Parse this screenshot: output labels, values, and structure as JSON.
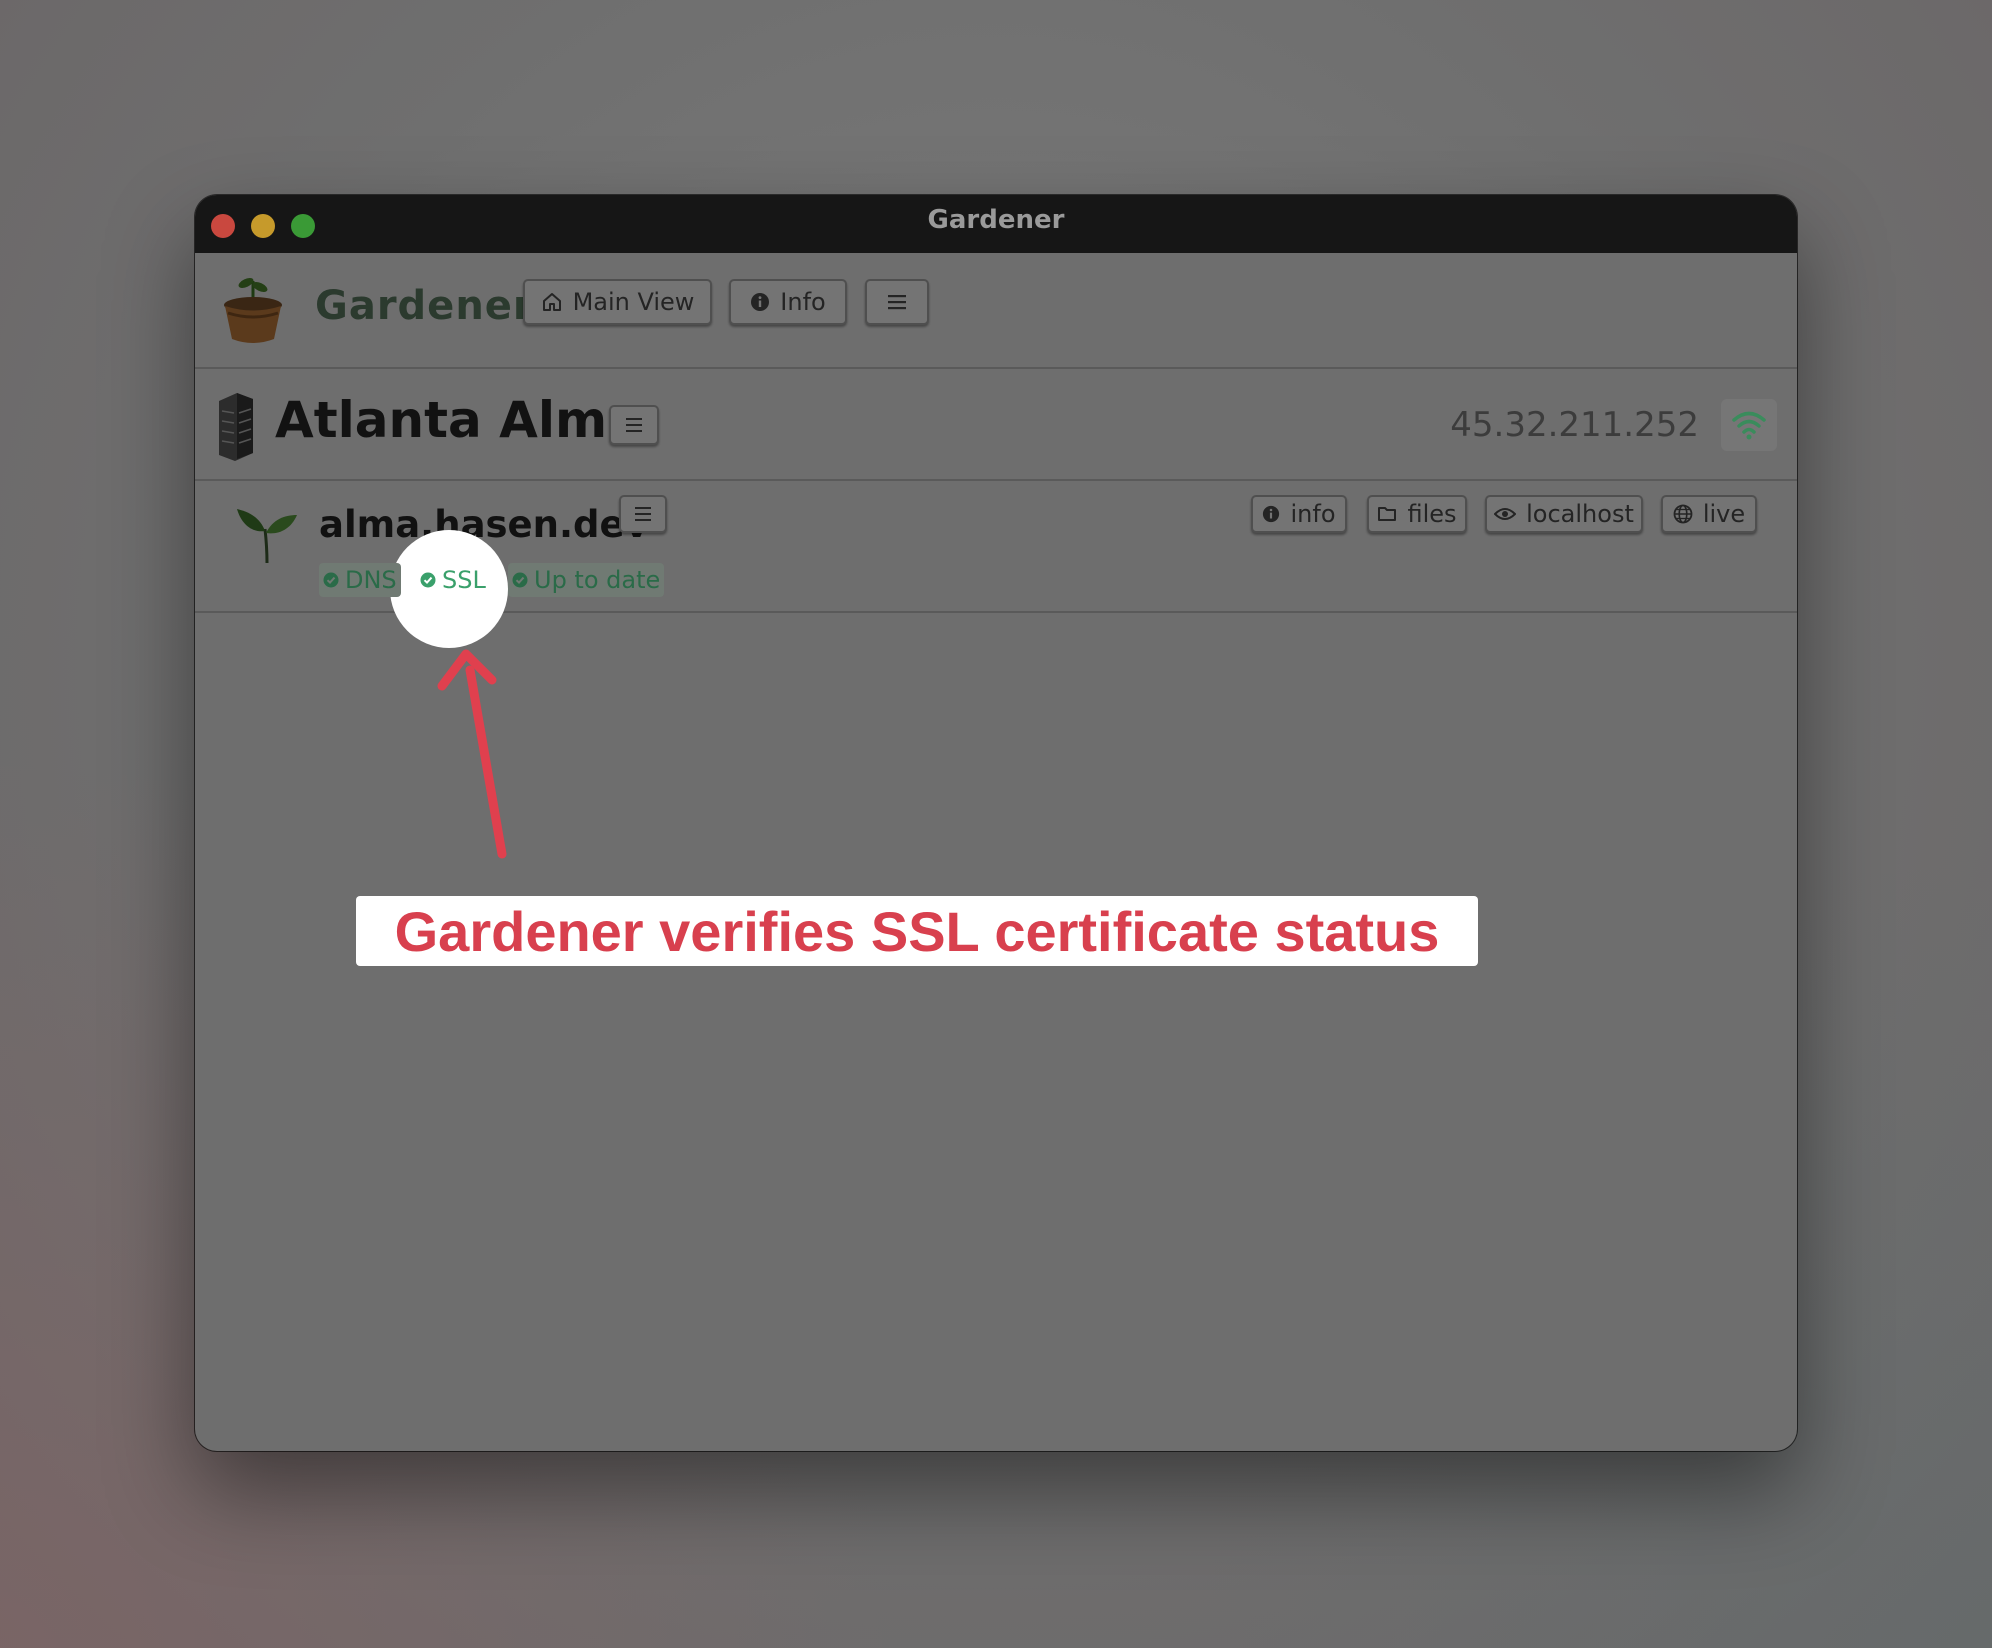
{
  "window": {
    "title": "Gardener"
  },
  "appbar": {
    "name": "Gardener",
    "main_view_label": "Main View",
    "info_label": "Info"
  },
  "server": {
    "name": "Atlanta Alma",
    "ip": "45.32.211.252",
    "status_icon": "wifi-icon"
  },
  "site": {
    "domain": "alma.hasen.dev",
    "tags": [
      {
        "label": "DNS",
        "status": "ok"
      },
      {
        "label": "SSL",
        "status": "ok"
      },
      {
        "label": "Up to date",
        "status": "ok"
      }
    ],
    "actions": [
      {
        "label": "info",
        "icon": "info-icon"
      },
      {
        "label": "files",
        "icon": "folder-icon"
      },
      {
        "label": "localhost",
        "icon": "eye-icon"
      },
      {
        "label": "live",
        "icon": "globe-icon"
      }
    ]
  },
  "annotation": {
    "text": "Gardener verifies SSL certificate status"
  },
  "colors": {
    "ok_green": "#3aa06b",
    "callout_red": "#d8404e"
  }
}
